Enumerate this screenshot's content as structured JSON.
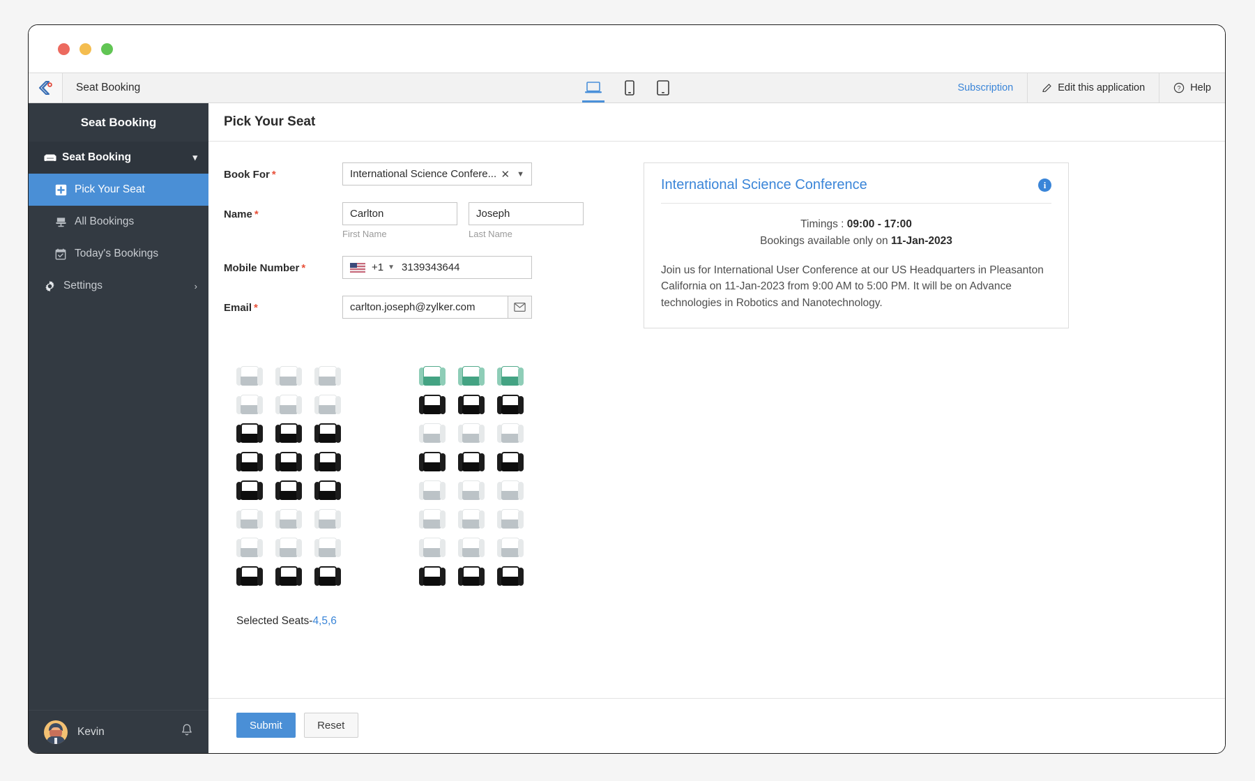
{
  "window": {
    "traffic_lights": [
      "close",
      "minimize",
      "maximize"
    ]
  },
  "appbar": {
    "logo_icon": "zoho-creator-logo-icon",
    "title": "Seat Booking",
    "devices": [
      {
        "icon": "laptop-icon",
        "active": true
      },
      {
        "icon": "mobile-icon",
        "active": false
      },
      {
        "icon": "tablet-icon",
        "active": false
      }
    ],
    "subscription_label": "Subscription",
    "edit_label": "Edit this application",
    "help_label": "Help",
    "link_color": "#3a85d8"
  },
  "sidebar": {
    "header": "Seat Booking",
    "group": {
      "label": "Seat Booking",
      "icon": "seat-icon",
      "chevron": "chevron-down-icon"
    },
    "items": [
      {
        "label": "Pick Your Seat",
        "icon": "plus-square-icon",
        "active": true
      },
      {
        "label": "All Bookings",
        "icon": "chair-icon",
        "active": false
      },
      {
        "label": "Today's Bookings",
        "icon": "calendar-check-icon",
        "active": false
      },
      {
        "label": "Settings",
        "icon": "gear-icon",
        "active": false,
        "chevron": "chevron-right-icon"
      }
    ],
    "user": {
      "name": "Kevin",
      "avatar": "user-avatar",
      "bell": "bell-icon"
    },
    "bg_color": "#333a42",
    "active_color": "#4a8fd6"
  },
  "page": {
    "title": "Pick Your Seat"
  },
  "form": {
    "book_for": {
      "label": "Book For",
      "required": "*",
      "value": "International Science Confere...",
      "clear_icon": "close-icon",
      "caret_icon": "chevron-down-icon"
    },
    "name": {
      "label": "Name",
      "required": "*",
      "first": {
        "value": "Carlton",
        "sub": "First Name",
        "placeholder": "First Name"
      },
      "last": {
        "value": "Joseph",
        "sub": "Last Name",
        "placeholder": "Last Name"
      }
    },
    "mobile": {
      "label": "Mobile Number",
      "required": "*",
      "flag": "us-flag-icon",
      "country_code": "+1",
      "value": "3139343644",
      "placeholder": "Mobile Number"
    },
    "email": {
      "label": "Email",
      "required": "*",
      "value": "carlton.joseph@zylker.com",
      "placeholder": "Email",
      "button_icon": "envelope-icon"
    }
  },
  "info_card": {
    "title": "International Science Conference",
    "info_icon": "info-icon",
    "timings_label": "Timings :",
    "timings_value": "09:00 - 17:00",
    "availability_label": "Bookings available only on",
    "availability_date": "11-Jan-2023",
    "description": "Join us for International User Conference at our US Headquarters in Pleasanton California on 11-Jan-2023 from 9:00 AM to 5:00 PM. It will be on Advance technologies in Robotics and Nanotechnology."
  },
  "seatmap": {
    "rows": 8,
    "cols_per_group": 3,
    "groups": 2,
    "legend": {
      "available": "#bcc3c7",
      "booked": "#0d0d0d",
      "selected": "#44a383"
    },
    "left_group": [
      [
        "available",
        "available",
        "available"
      ],
      [
        "available",
        "available",
        "available"
      ],
      [
        "booked",
        "booked",
        "booked"
      ],
      [
        "booked",
        "booked",
        "booked"
      ],
      [
        "booked",
        "booked",
        "booked"
      ],
      [
        "available",
        "available",
        "available"
      ],
      [
        "available",
        "available",
        "available"
      ],
      [
        "booked",
        "booked",
        "booked"
      ]
    ],
    "right_group": [
      [
        "selected",
        "selected",
        "selected"
      ],
      [
        "booked",
        "booked",
        "booked"
      ],
      [
        "available",
        "available",
        "available"
      ],
      [
        "booked",
        "booked",
        "booked"
      ],
      [
        "available",
        "available",
        "available"
      ],
      [
        "available",
        "available",
        "available"
      ],
      [
        "available",
        "available",
        "available"
      ],
      [
        "booked",
        "booked",
        "booked"
      ]
    ]
  },
  "selected_seats": {
    "label": "Selected Seats-",
    "value": "4,5,6"
  },
  "footer": {
    "submit_label": "Submit",
    "reset_label": "Reset",
    "primary_color": "#4a8fd6"
  }
}
